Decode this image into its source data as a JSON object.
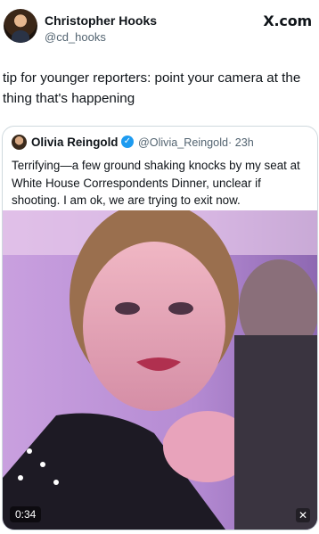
{
  "author": {
    "name": "Christopher Hooks",
    "handle": "@cd_hooks"
  },
  "brand": {
    "logo_text": "X.com"
  },
  "tweet": {
    "text": "tip for younger reporters: point your camera at the thing that's happening"
  },
  "quoted": {
    "name": "Olivia Reingold",
    "handle": "@Olivia_Reingold",
    "time": "· 23h",
    "verified_icon": "verified-badge-icon",
    "text": "Terrifying—a few ground shaking knocks by my seat at White House Correspondents Dinner, unclear if shooting. I am ok, we are trying to exit now.",
    "video": {
      "duration": "0:34",
      "mute_icon": "mute-icon"
    }
  },
  "colors": {
    "text": "#0f1419",
    "secondary": "#536471",
    "verified": "#1d9bf0",
    "border": "#cfd9de"
  }
}
